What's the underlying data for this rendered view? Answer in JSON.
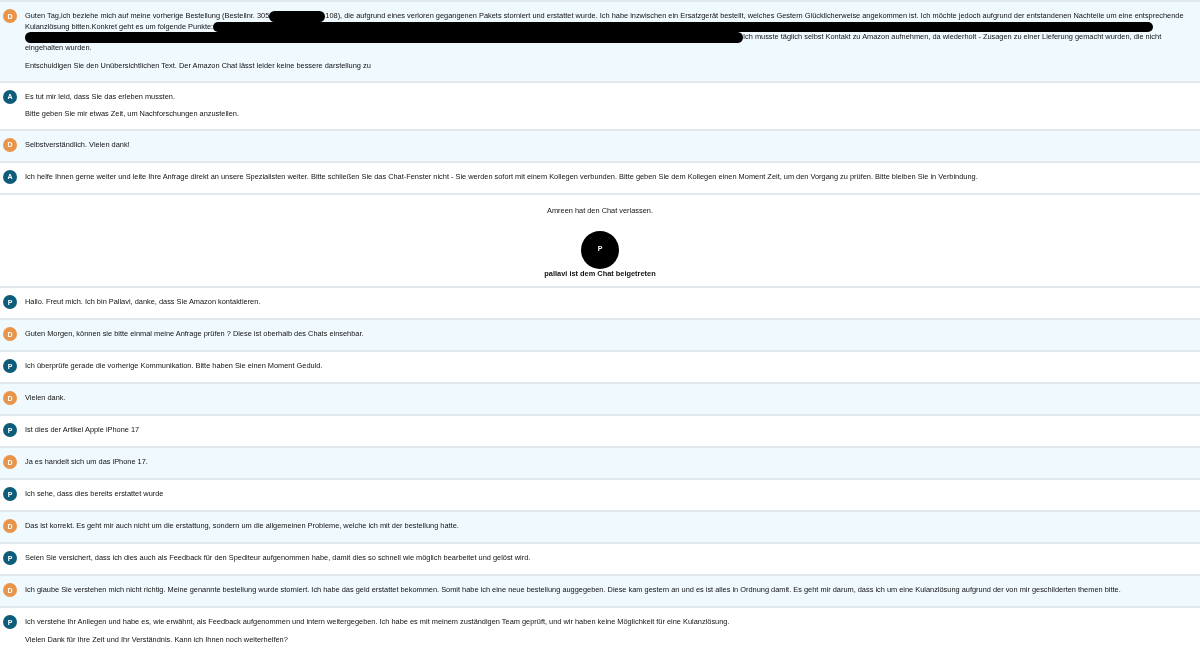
{
  "messages": [
    {
      "kind": "message",
      "highlighted": true,
      "color": "#e8954a",
      "initial": "D",
      "paragraphs": [
        [
          [
            {
              "kind": "text",
              "text": "Guten Tag,ich beziehe mich auf meine vorherige Bestellung (Bestellnr. 305"
            },
            {
              "kind": "redaction"
            },
            {
              "kind": "text",
              "text": "108), die aufgrund eines verloren gegangenen Pakets storniert und erstattet wurde. Ich habe inzwischen ein Ersatzgerät bestellt, welches Gestern Glücklicherweise angekommen ist. Ich möchte jedoch aufgrund der entstandenen Nachteile um eine entsprechende"
            }
          ],
          [
            {
              "kind": "text",
              "text": "Kulanzlösung bitten.Konkret geht es um folgende Punkte:"
            },
            {
              "kind": "redaction"
            }
          ],
          [
            {
              "kind": "redaction"
            },
            {
              "kind": "text",
              "text": "Ich musste täglich selbst Kontakt zu Amazon aufnehmen, da wiederholt - Zusagen zu einer Lieferung gemacht wurden, die nicht"
            }
          ],
          [
            {
              "kind": "text",
              "text": "eingehalten wurden."
            }
          ]
        ],
        [
          [
            {
              "kind": "text",
              "text": "Entschuldigen Sie den Unübersichtlichen Text. Der Amazon Chat lässt leider keine bessere darstellung zu"
            }
          ]
        ]
      ]
    },
    {
      "kind": "message",
      "highlighted": false,
      "color": "#0e5b7a",
      "initial": "A",
      "paragraphs": [
        [
          [
            {
              "kind": "text",
              "text": "Es tut mir leid, dass Sie das erleben mussten."
            }
          ]
        ],
        [
          [
            {
              "kind": "text",
              "text": "Bitte geben Sie mir etwas Zeit, um Nachforschungen anzustellen."
            }
          ]
        ]
      ]
    },
    {
      "kind": "message",
      "highlighted": true,
      "color": "#e8954a",
      "initial": "D",
      "paragraphs": [
        [
          [
            {
              "kind": "text",
              "text": "Selbstverständlich. Vielen dank!"
            }
          ]
        ]
      ]
    },
    {
      "kind": "message",
      "highlighted": false,
      "color": "#0e5b7a",
      "initial": "A",
      "paragraphs": [
        [
          [
            {
              "kind": "text",
              "text": "Ich helfe Ihnen gerne weiter und leite Ihre Anfrage direkt an unsere Spezialisten weiter. Bitte schließen Sie das Chat-Fenster nicht - Sie werden sofort mit einem Kollegen verbunden. Bitte geben Sie dem Kollegen einen Moment Zeit, um den Vorgang zu prüfen. Bitte bleiben Sie in Verbindung."
            }
          ]
        ]
      ]
    },
    {
      "kind": "left",
      "text": "Amreen hat den Chat verlassen."
    },
    {
      "kind": "joined",
      "initial": "P",
      "text": "pallavi ist dem Chat beigetreten"
    },
    {
      "kind": "message",
      "highlighted": false,
      "color": "#0e5b7a",
      "initial": "P",
      "paragraphs": [
        [
          [
            {
              "kind": "text",
              "text": "Hallo. Freut mich. Ich bin Pallavi, danke, dass Sie Amazon kontaktieren."
            }
          ]
        ]
      ]
    },
    {
      "kind": "message",
      "highlighted": true,
      "color": "#e8954a",
      "initial": "D",
      "paragraphs": [
        [
          [
            {
              "kind": "text",
              "text": "Guten Morgen, können sie bitte einmal meine Anfrage prüfen ? Diese ist oberhalb des Chats einsehbar."
            }
          ]
        ]
      ]
    },
    {
      "kind": "message",
      "highlighted": false,
      "color": "#0e5b7a",
      "initial": "P",
      "paragraphs": [
        [
          [
            {
              "kind": "text",
              "text": "Ich überprüfe gerade die vorherige Kommunikation. Bitte haben Sie einen Moment Geduld."
            }
          ]
        ]
      ]
    },
    {
      "kind": "message",
      "highlighted": true,
      "color": "#e8954a",
      "initial": "D",
      "paragraphs": [
        [
          [
            {
              "kind": "text",
              "text": "Vielen dank."
            }
          ]
        ]
      ]
    },
    {
      "kind": "message",
      "highlighted": false,
      "color": "#0e5b7a",
      "initial": "P",
      "paragraphs": [
        [
          [
            {
              "kind": "text",
              "text": "Ist dies der Artikel Apple iPhone 17"
            }
          ]
        ]
      ]
    },
    {
      "kind": "message",
      "highlighted": true,
      "color": "#e8954a",
      "initial": "D",
      "paragraphs": [
        [
          [
            {
              "kind": "text",
              "text": "Ja es handelt sich um das iPhone 17."
            }
          ]
        ]
      ]
    },
    {
      "kind": "message",
      "highlighted": false,
      "color": "#0e5b7a",
      "initial": "P",
      "paragraphs": [
        [
          [
            {
              "kind": "text",
              "text": "Ich sehe, dass dies bereits erstattet wurde"
            }
          ]
        ]
      ]
    },
    {
      "kind": "message",
      "highlighted": true,
      "color": "#e8954a",
      "initial": "D",
      "paragraphs": [
        [
          [
            {
              "kind": "text",
              "text": "Das ist korrekt. Es geht mir auch nicht um die erstattung, sondern um die allgemeinen Probleme, welche ich mit der bestellung hatte."
            }
          ]
        ]
      ]
    },
    {
      "kind": "message",
      "highlighted": false,
      "color": "#0e5b7a",
      "initial": "P",
      "paragraphs": [
        [
          [
            {
              "kind": "text",
              "text": "Seien Sie versichert, dass ich dies auch als Feedback für den Spediteur aufgenommen habe, damit dies so schnell wie möglich bearbeitet und gelöst wird."
            }
          ]
        ]
      ]
    },
    {
      "kind": "message",
      "highlighted": true,
      "color": "#e8954a",
      "initial": "D",
      "paragraphs": [
        [
          [
            {
              "kind": "text",
              "text": "Ich glaube Sie verstehen mich nicht richtig. Meine genannte bestellung wurde storniert. Ich habe das geld erstattet bekommen. Somit habe ich eine neue bestellung auggegeben. Diese kam gestern an und es ist alles in Ordnung damit. Es geht mir darum, dass ich um eine Kulanzlösung aufgrund der von mir geschilderten themen bitte."
            }
          ]
        ]
      ]
    },
    {
      "kind": "message",
      "highlighted": false,
      "color": "#0e5b7a",
      "initial": "P",
      "paragraphs": [
        [
          [
            {
              "kind": "text",
              "text": "Ich verstehe Ihr Anliegen und habe es, wie erwähnt, als Feedback aufgenommen und intern weitergegeben. Ich habe es mit meinem zuständigen Team geprüft, und wir haben keine Möglichkeit für eine Kulanzlösung."
            }
          ]
        ],
        [
          [
            {
              "kind": "text",
              "text": "Vielen Dank für Ihre Zeit und Ihr Verständnis. Kann ich Ihnen noch weiterhelfen?"
            }
          ]
        ]
      ]
    }
  ]
}
